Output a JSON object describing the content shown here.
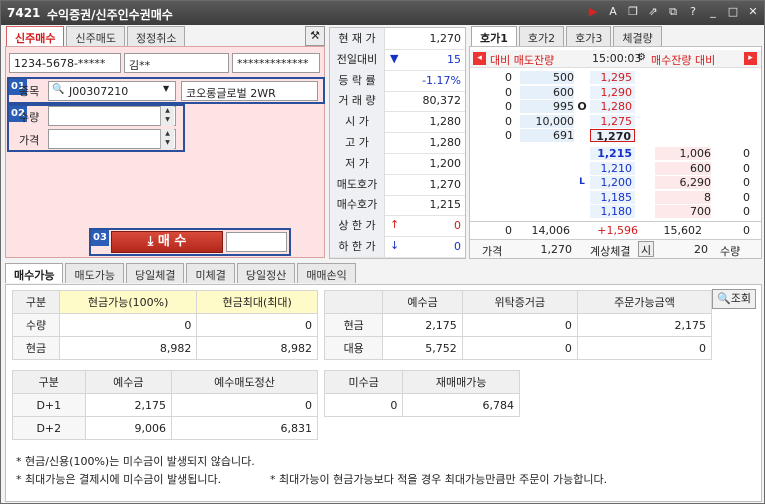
{
  "window": {
    "code": "7421",
    "title": "수익증권/신주인수권매수"
  },
  "order_tabs": [
    "신주매수",
    "신주매도",
    "정정취소"
  ],
  "account": {
    "number": "1234-5678-*****",
    "name": "김**",
    "password": "*************"
  },
  "callouts": [
    "01",
    "02",
    "03"
  ],
  "form": {
    "symbol_label": "종목",
    "symbol_code": "J00307210",
    "symbol_name": "코오롱글로벌 2WR",
    "qty_label": "수량",
    "price_label": "가격",
    "buy_label": "매 수"
  },
  "quote": {
    "rows": [
      {
        "k": "현 재 가",
        "v": "1,270",
        "cls": ""
      },
      {
        "k": "전일대비",
        "v": "15",
        "cls": "blue",
        "arrow": "▼"
      },
      {
        "k": "등 락 률",
        "v": "-1.17%",
        "cls": "blue"
      },
      {
        "k": "거 래 량",
        "v": "80,372",
        "cls": ""
      },
      {
        "k": "시    가",
        "v": "1,280",
        "cls": ""
      },
      {
        "k": "고    가",
        "v": "1,280",
        "cls": ""
      },
      {
        "k": "저    가",
        "v": "1,200",
        "cls": ""
      },
      {
        "k": "매도호가",
        "v": "1,270",
        "cls": ""
      },
      {
        "k": "매수호가",
        "v": "1,215",
        "cls": ""
      },
      {
        "k": "상 한 가",
        "v": "0",
        "cls": "red",
        "arrow": "↑"
      },
      {
        "k": "하 한 가",
        "v": "0",
        "cls": "blue",
        "arrow": "↓"
      }
    ]
  },
  "hoga": {
    "tabs": [
      "호가1",
      "호가2",
      "호가3",
      "체결량"
    ],
    "header": {
      "left": "대비 매도잔량",
      "time": "15:00:03",
      "right": "매수잔량 대비"
    },
    "asks": [
      {
        "diff": "0",
        "qty": "500",
        "price": "1,295"
      },
      {
        "diff": "0",
        "qty": "600",
        "price": "1,290"
      },
      {
        "diff": "0",
        "qty": "995",
        "price": "1,280",
        "mark": "O"
      },
      {
        "diff": "0",
        "qty": "10,000",
        "price": "1,275"
      },
      {
        "diff": "0",
        "qty": "691",
        "price": "1,270"
      }
    ],
    "bids": [
      {
        "price": "1,215",
        "qty": "1,006",
        "diff": "0"
      },
      {
        "price": "1,210",
        "qty": "600",
        "diff": "0"
      },
      {
        "price": "1,200",
        "qty": "6,290",
        "diff": "0",
        "mark": "L"
      },
      {
        "price": "1,185",
        "qty": "8",
        "diff": "0"
      },
      {
        "price": "1,180",
        "qty": "700",
        "diff": "0"
      }
    ],
    "totals": {
      "ask_diff": "0",
      "ask_qty": "14,006",
      "bid_diff": "+1,596",
      "bid_qty": "15,602",
      "bid_diff2": "0"
    },
    "footer": {
      "price_label": "가격",
      "price": "1,270",
      "calc_label": "계상체결",
      "calc_btn": "시",
      "qty": "20",
      "qty_label": "수량"
    }
  },
  "bottom_tabs": [
    "매수가능",
    "매도가능",
    "당일체결",
    "미체결",
    "당일정산",
    "매매손익"
  ],
  "query_button": "조회",
  "avail": {
    "headers": [
      "구분",
      "현금가능(100%)",
      "현금최대(최대)"
    ],
    "rows": [
      [
        "수량",
        "0",
        "0"
      ],
      [
        "현금",
        "8,982",
        "8,982"
      ]
    ]
  },
  "deposit": {
    "headers": [
      "",
      "예수금",
      "위탁증거금",
      "주문가능금액"
    ],
    "rows": [
      [
        "현금",
        "2,175",
        "0",
        "2,175"
      ],
      [
        "대용",
        "5,752",
        "0",
        "0"
      ]
    ]
  },
  "settle": {
    "headers": [
      "구분",
      "예수금",
      "예수매도정산"
    ],
    "rows": [
      [
        "D+1",
        "2,175",
        "0"
      ],
      [
        "D+2",
        "9,006",
        "6,831"
      ]
    ]
  },
  "unpaid": {
    "headers": [
      "미수금",
      "재매매가능"
    ],
    "rows": [
      [
        "0",
        "6,784"
      ]
    ]
  },
  "notes": [
    "* 현금/신용(100%)는 미수금이 발생되지 않습니다.",
    "* 최대가능은 결제시에 미수금이 발생됩니다.",
    "* 최대가능이 현금가능보다 적을 경우 최대가능만큼만 주문이 가능합니다."
  ]
}
